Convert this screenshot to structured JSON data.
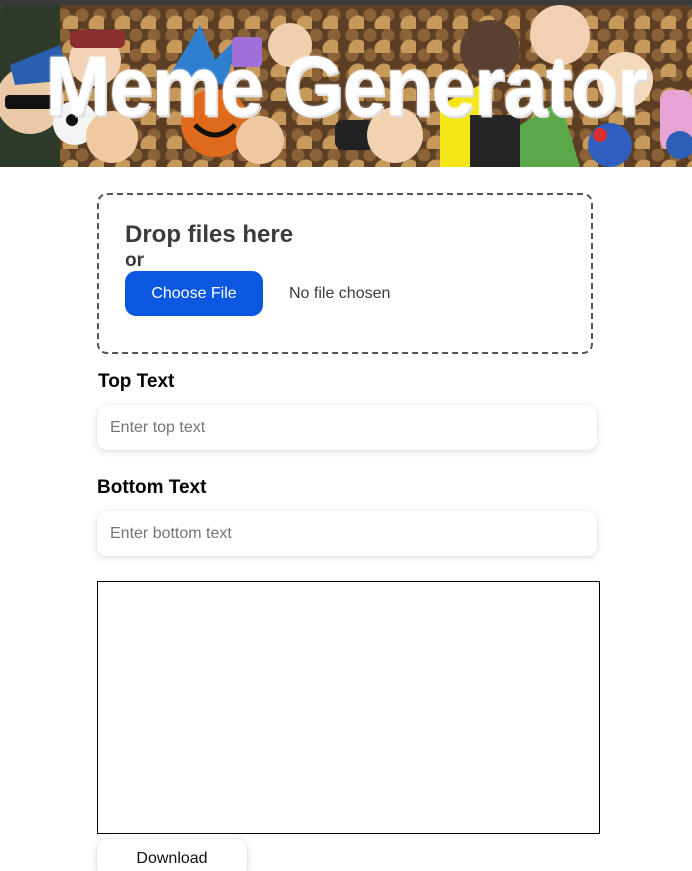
{
  "banner": {
    "title": "Meme Generator"
  },
  "dropzone": {
    "title": "Drop files here",
    "or_label": "or",
    "choose_button": "Choose File",
    "file_status": "No file chosen"
  },
  "top_text": {
    "label": "Top Text",
    "placeholder": "Enter top text"
  },
  "bottom_text": {
    "label": "Bottom Text",
    "placeholder": "Enter bottom text"
  },
  "download_button": "Download",
  "colors": {
    "accent": "#0b57e0",
    "text": "#3b3b3b",
    "page_background": "#ffffff"
  }
}
